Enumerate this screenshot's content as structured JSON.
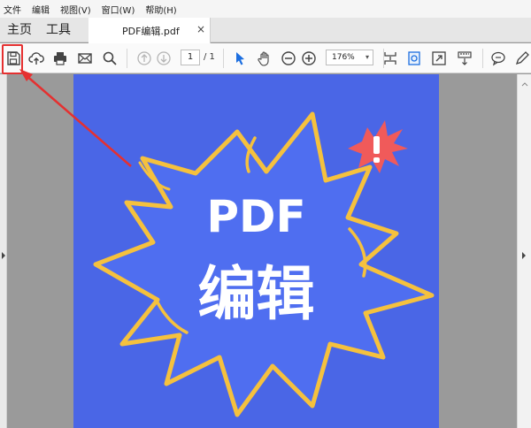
{
  "menu": {
    "items": [
      "文件",
      "编辑",
      "视图(V)",
      "窗口(W)",
      "帮助(H)"
    ]
  },
  "tabs": {
    "home": "主页",
    "tools": "工具",
    "document": "PDF编辑.pdf",
    "close": "×"
  },
  "toolbar": {
    "page_current": "1",
    "page_total": "/ 1",
    "zoom": "176%"
  },
  "document": {
    "line1": "PDF",
    "line2": "编辑"
  },
  "colors": {
    "page_bg": "#4a66e6",
    "burst_stroke": "#f5c13e",
    "badge": "#f05a5a",
    "highlight": "#e53030"
  }
}
